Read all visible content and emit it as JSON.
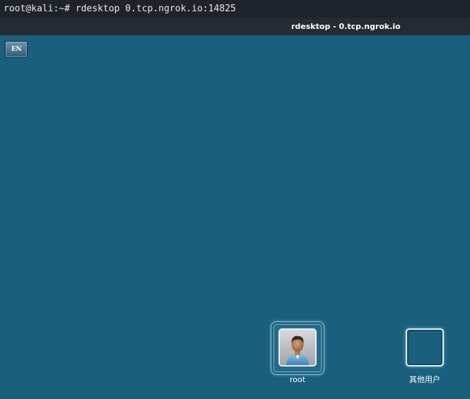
{
  "terminal": {
    "command_line": "root@kali:~# rdesktop 0.tcp.ngrok.io:14825"
  },
  "window": {
    "title": "rdesktop - 0.tcp.ngrok.io"
  },
  "desktop": {
    "background_color": "#1a5f7e",
    "language_indicator": "EN",
    "users": [
      {
        "name": "root",
        "icon": "user-avatar-icon"
      },
      {
        "name": "其他用户",
        "icon": "empty-user-frame"
      }
    ]
  }
}
